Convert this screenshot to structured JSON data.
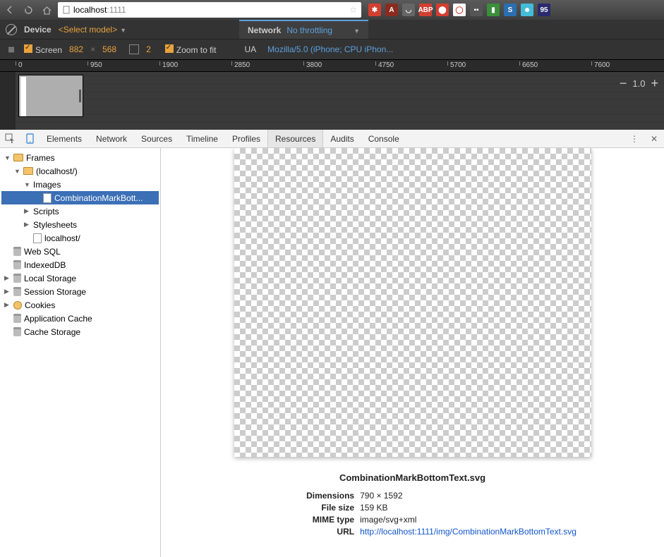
{
  "browser": {
    "url_display_host": "localhost",
    "url_display_port": ":1111"
  },
  "ext_icons": [
    {
      "bg": "#d23f31",
      "txt": "✱"
    },
    {
      "bg": "#8a2b1f",
      "txt": "A"
    },
    {
      "bg": "#666",
      "txt": "◡"
    },
    {
      "bg": "#d23f31",
      "txt": "ABP"
    },
    {
      "bg": "#d23f31",
      "txt": "⬤"
    },
    {
      "bg": "#fff",
      "txt": "◯",
      "fg": "#d23f31"
    },
    {
      "bg": "#555",
      "txt": "▪▪"
    },
    {
      "bg": "#3a8f3a",
      "txt": "▮"
    },
    {
      "bg": "#2a6fb0",
      "txt": "S"
    },
    {
      "bg": "#44bcd8",
      "txt": "☻"
    },
    {
      "bg": "#2a2a6f",
      "txt": "95"
    }
  ],
  "device": {
    "device_label": "Device",
    "model_placeholder": "<Select model>",
    "screen_label": "Screen",
    "width": "882",
    "height": "568",
    "dpr": "2",
    "zoom_label": "Zoom to fit",
    "network_label": "Network",
    "throttle": "No throttling",
    "ua_label": "UA",
    "ua_value": "Mozilla/5.0 (iPhone; CPU iPhon...",
    "zoom_level": "1.0"
  },
  "ruler_ticks": [
    "0",
    "950",
    "1900",
    "2850",
    "3800",
    "4750",
    "5700",
    "6650",
    "7600"
  ],
  "devtools": {
    "tabs": [
      "Elements",
      "Network",
      "Sources",
      "Timeline",
      "Profiles",
      "Resources",
      "Audits",
      "Console"
    ],
    "active_tab": "Resources"
  },
  "tree": [
    {
      "ind": 0,
      "arr": "open",
      "icon": "folder",
      "label": "Frames"
    },
    {
      "ind": 1,
      "arr": "open",
      "icon": "folder",
      "label": "(localhost/)"
    },
    {
      "ind": 2,
      "arr": "open",
      "icon": "none",
      "label": "Images"
    },
    {
      "ind": 3,
      "arr": "none",
      "icon": "file",
      "label": "CombinationMarkBott...",
      "sel": true
    },
    {
      "ind": 2,
      "arr": "closed",
      "icon": "none",
      "label": "Scripts"
    },
    {
      "ind": 2,
      "arr": "closed",
      "icon": "none",
      "label": "Stylesheets"
    },
    {
      "ind": 2,
      "arr": "none",
      "icon": "file",
      "label": "localhost/"
    },
    {
      "ind": 0,
      "arr": "none",
      "icon": "db",
      "label": "Web SQL"
    },
    {
      "ind": 0,
      "arr": "none",
      "icon": "db",
      "label": "IndexedDB"
    },
    {
      "ind": 0,
      "arr": "closed",
      "icon": "db",
      "label": "Local Storage"
    },
    {
      "ind": 0,
      "arr": "closed",
      "icon": "db",
      "label": "Session Storage"
    },
    {
      "ind": 0,
      "arr": "closed",
      "icon": "cookie",
      "label": "Cookies"
    },
    {
      "ind": 0,
      "arr": "none",
      "icon": "db",
      "label": "Application Cache"
    },
    {
      "ind": 0,
      "arr": "none",
      "icon": "db",
      "label": "Cache Storage"
    }
  ],
  "resource": {
    "filename": "CombinationMarkBottomText.svg",
    "labels": {
      "dimensions": "Dimensions",
      "filesize": "File size",
      "mime": "MIME type",
      "url": "URL"
    },
    "dimensions": "790 × 1592",
    "filesize": "159 KB",
    "mime": "image/svg+xml",
    "url": "http://localhost:1111/img/CombinationMarkBottomText.svg"
  }
}
